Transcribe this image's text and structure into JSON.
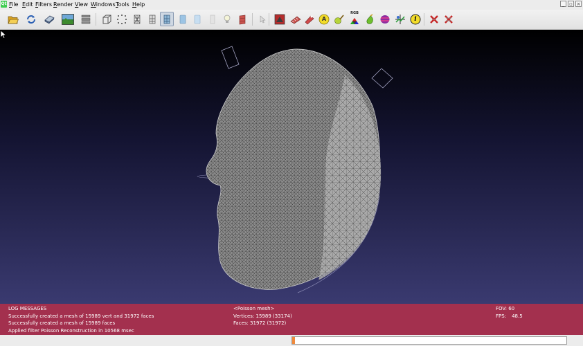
{
  "app": {
    "logo_text": "Qt"
  },
  "menu": {
    "items": [
      {
        "label": "File"
      },
      {
        "label": "Edit"
      },
      {
        "label": "Filters"
      },
      {
        "label": "Render"
      },
      {
        "label": "View"
      },
      {
        "label": "Windows"
      },
      {
        "label": "Tools"
      },
      {
        "label": "Help"
      }
    ]
  },
  "window_controls": {
    "minimize": "_",
    "restore": "▫",
    "close": "×"
  },
  "toolbar": {
    "active_button": "smooth-shading-button",
    "rgb_label": "RGB",
    "info_glyph": "i",
    "annotation_glyph": "A"
  },
  "log": {
    "title": "LOG MESSAGES",
    "lines": [
      "Successfully created a mesh of 15989 vert and 31972 faces",
      "Successfully created a mesh of 15989 faces",
      "Applied filter Poisson Reconstruction in 10568 msec"
    ]
  },
  "mesh": {
    "name": "<Poisson mesh>",
    "vertices": "Vertices: 15989 (33174)",
    "faces": "Faces: 31972 (31972)"
  },
  "view": {
    "fov": "FOV: 60",
    "fps_label": "FPS:",
    "fps_value": "48.5"
  },
  "status": {
    "progress": 0.01
  },
  "colors": {
    "info_panel": "#a3304e",
    "progress_fill": "#f08a3c"
  }
}
